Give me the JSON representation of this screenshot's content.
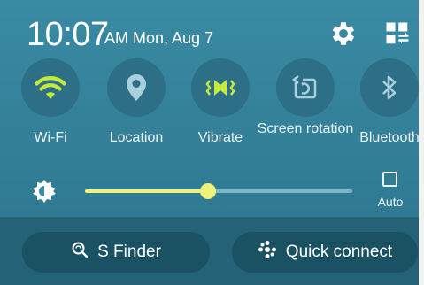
{
  "header": {
    "time": "10:07",
    "date": "AM Mon, Aug 7"
  },
  "quick_settings": [
    {
      "label": "Wi-Fi",
      "icon": "wifi-icon",
      "active": true
    },
    {
      "label": "Location",
      "icon": "location-pin-icon",
      "active": false
    },
    {
      "label": "Vibrate",
      "icon": "vibrate-icon",
      "active": true
    },
    {
      "label": "Screen rotation",
      "icon": "screen-rotation-icon",
      "active": false
    },
    {
      "label": "Bluetooth",
      "icon": "bluetooth-icon",
      "active": false
    }
  ],
  "brightness": {
    "level": 0.46,
    "auto_label": "Auto",
    "auto_checked": false
  },
  "bottom_buttons": {
    "s_finder": "S Finder",
    "quick_connect": "Quick connect"
  },
  "colors": {
    "active_icon": "#c6ea38",
    "inactive_icon": "#a9d0dc",
    "slider_fill": "#eef27a"
  }
}
